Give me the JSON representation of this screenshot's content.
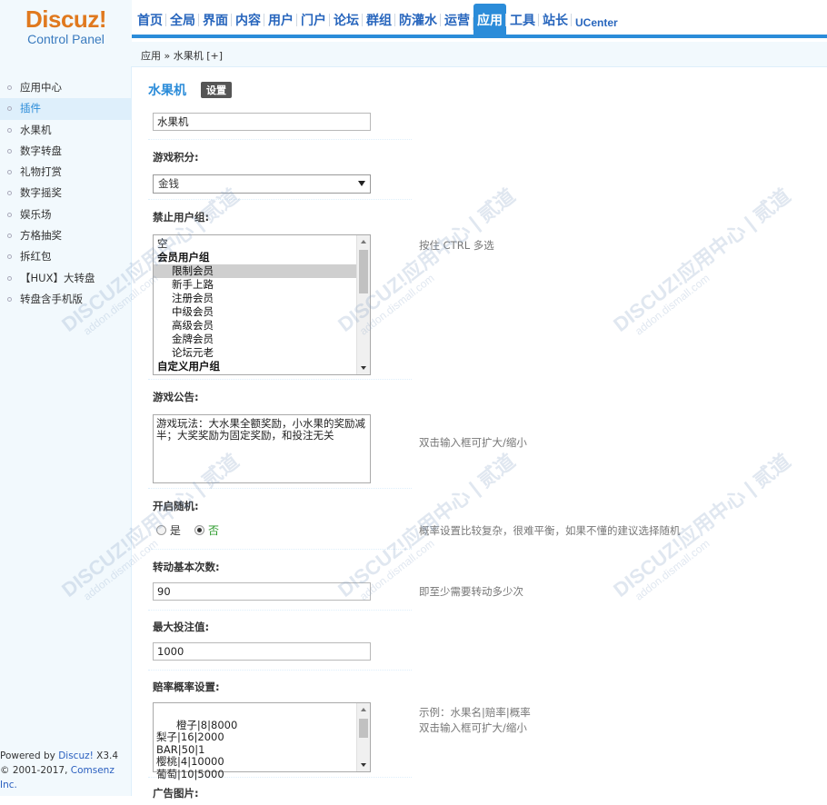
{
  "header": {
    "logo_brand": "Discuz!",
    "logo_sub": "Control Panel",
    "nav": [
      "首页",
      "全局",
      "界面",
      "内容",
      "用户",
      "门户",
      "论坛",
      "群组",
      "防灌水",
      "运营",
      "应用",
      "工具",
      "站长",
      "UCenter"
    ],
    "active_nav": "应用"
  },
  "breadcrumb": "应用 » 水果机 [+]",
  "sidebar": {
    "items": [
      "应用中心",
      "插件",
      "水果机",
      "数字转盘",
      "礼物打赏",
      "数字摇奖",
      "娱乐场",
      "方格抽奖",
      "拆红包",
      "【HUX】大转盘",
      "转盘含手机版"
    ],
    "active_item": "插件",
    "footer_line1_prefix": "Powered by ",
    "footer_line1_link": "Discuz!",
    "footer_line1_suffix": " X3.4",
    "footer_line2_prefix": "© 2001-2017, ",
    "footer_line2_link": "Comsenz Inc."
  },
  "main": {
    "title": "水果机",
    "title_button": "设置",
    "name_value": "水果机",
    "credit_label": "游戏积分:",
    "credit_value": "金钱",
    "ban_label": "禁止用户组:",
    "ban_options": [
      {
        "text": "空",
        "kind": "plain"
      },
      {
        "text": "会员用户组",
        "kind": "grp"
      },
      {
        "text": "限制会员",
        "kind": "sub-sel"
      },
      {
        "text": "新手上路",
        "kind": "sub"
      },
      {
        "text": "注册会员",
        "kind": "sub"
      },
      {
        "text": "中级会员",
        "kind": "sub"
      },
      {
        "text": "高级会员",
        "kind": "sub"
      },
      {
        "text": "金牌会员",
        "kind": "sub"
      },
      {
        "text": "论坛元老",
        "kind": "sub"
      },
      {
        "text": "自定义用户组",
        "kind": "grp"
      }
    ],
    "ban_tip": "按住 CTRL 多选",
    "notice_label": "游戏公告:",
    "notice_value": "游戏玩法：大水果全额奖励，小水果的奖励减半；大奖奖励为固定奖励，和投注无关",
    "notice_tip": "双击输入框可扩大/缩小",
    "random_label": "开启随机:",
    "random_yes": "是",
    "random_no": "否",
    "random_tip": "概率设置比较复杂，很难平衡，如果不懂的建议选择随机",
    "spin_label": "转动基本次数:",
    "spin_value": "90",
    "spin_tip": "即至少需要转动多少次",
    "maxbet_label": "最大投注值:",
    "maxbet_value": "1000",
    "odds_label": "赔率概率设置:",
    "odds_value": "橙子|8|8000\n梨子|16|2000\nBAR|50|1\n樱桃|4|10000\n葡萄|10|5000",
    "odds_tip1": "示例：水果名|赔率|概率",
    "odds_tip2": "双击输入框可扩大/缩小",
    "ad_label": "广告图片:"
  },
  "watermark": {
    "big": "DISCUZ!应用中心 | 贰道",
    "small": "addon.dismall.com"
  }
}
